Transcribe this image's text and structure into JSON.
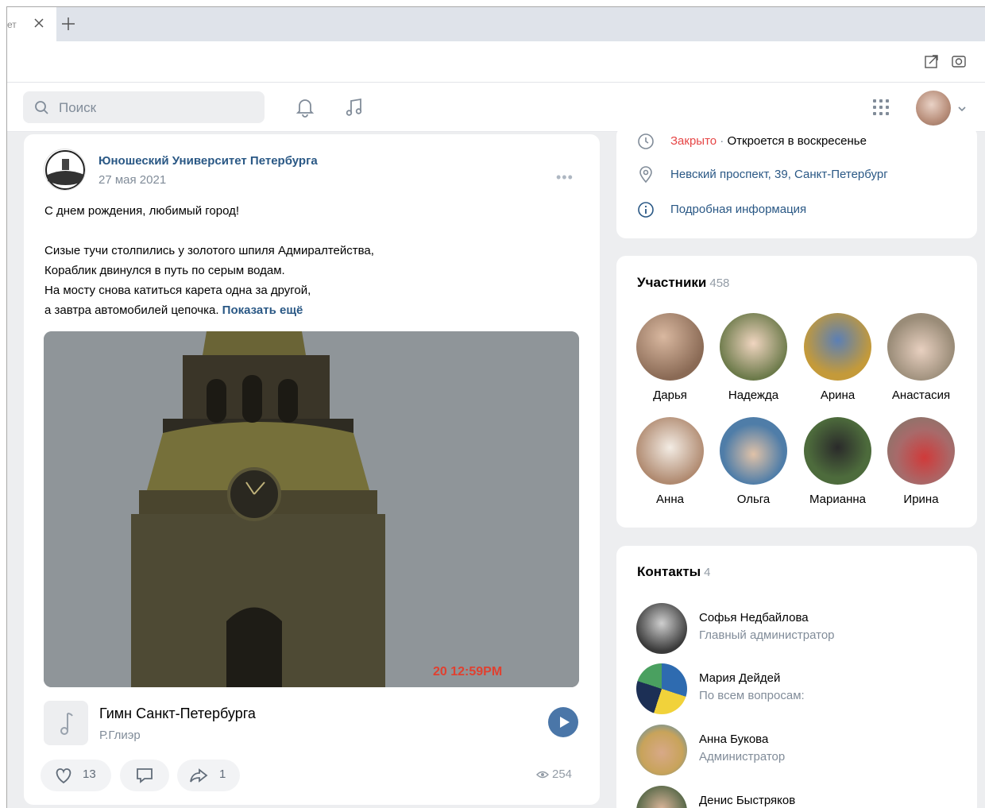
{
  "browser": {
    "tab_title": "ет",
    "tab_close_icon": "close-icon",
    "new_tab_icon": "plus-icon",
    "toolbar_icons": [
      "share-icon",
      "screenshot-icon"
    ]
  },
  "header": {
    "search_placeholder": "Поиск",
    "icons": [
      "bell-icon",
      "music-icon",
      "apps-grid-icon",
      "chevron-down-icon"
    ]
  },
  "post": {
    "author": "Юношеский Университет Петербурга",
    "date": "27 мая 2021",
    "lines": [
      "С днем рождения, любимый город!",
      "Сизые тучи столпились у золотого шпиля Адмиралтейства,",
      "Кораблик двинулся в путь по серым водам.",
      "На мосту снова катиться карета одна за другой,",
      "а завтра автомобилей цепочка."
    ],
    "show_more": "Показать ещё",
    "photo_stamp": "20 12:59PM",
    "audio": {
      "title": "Гимн Санкт-Петербурга",
      "artist": "Р.Глиэр"
    },
    "likes": "13",
    "shares": "1",
    "views": "254"
  },
  "info": {
    "status": "Закрыто",
    "status_sep": " · ",
    "status_detail": "Откроется в воскресенье",
    "address": "Невский проспект, 39, Санкт-Петербург",
    "details": "Подробная информация"
  },
  "members": {
    "title": "Участники",
    "count": "458",
    "items": [
      {
        "name": "Дарья",
        "color": "#8a6a55"
      },
      {
        "name": "Надежда",
        "color": "#6c7a4a"
      },
      {
        "name": "Арина",
        "color": "#c49a3a"
      },
      {
        "name": "Анастасия",
        "color": "#9a8c78"
      },
      {
        "name": "Анна",
        "color": "#b08a70"
      },
      {
        "name": "Ольга",
        "color": "#4f7da8"
      },
      {
        "name": "Марианна",
        "color": "#4d6b3c"
      },
      {
        "name": "Ирина",
        "color": "#a86a6a"
      }
    ]
  },
  "contacts": {
    "title": "Контакты",
    "count": "4",
    "items": [
      {
        "name": "Софья Недбайлова",
        "role": "Главный администратор",
        "color": "#777777"
      },
      {
        "name": "Мария Дейдей",
        "role": "По всем вопросам:",
        "color": "#2e6bb0"
      },
      {
        "name": "Анна Букова",
        "role": "Администратор",
        "color": "#c8a35a"
      },
      {
        "name": "Денис Быстряков",
        "role": "",
        "color": "#5a6a4a"
      }
    ]
  },
  "colors": {
    "link": "#2a5885",
    "closed": "#e64646",
    "accent": "#4a76a8"
  }
}
